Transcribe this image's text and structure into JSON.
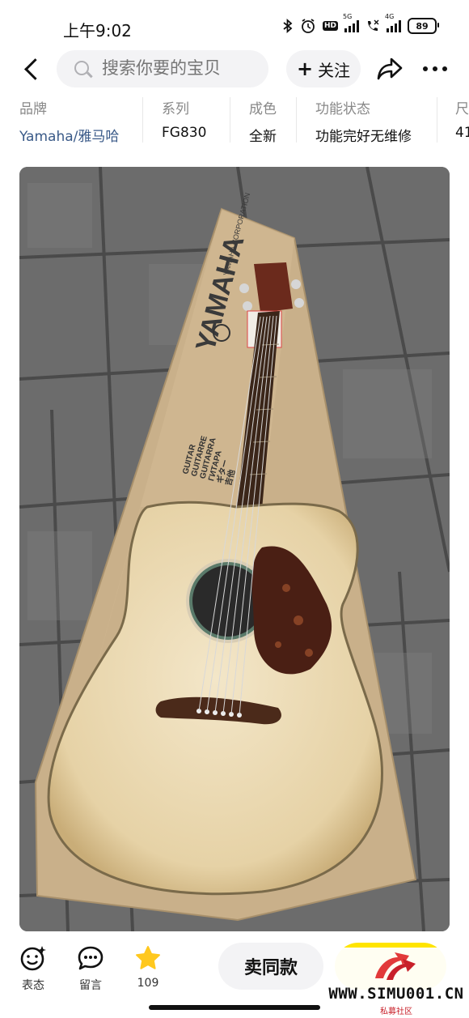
{
  "status_bar": {
    "time": "上午9:02",
    "signal1_label": "5G",
    "signal2_label": "4G",
    "hd_label": "HD",
    "battery": "89",
    "icons": [
      "bluetooth-icon",
      "alarm-icon",
      "hd-icon",
      "signal-icon",
      "call-icon",
      "signal-icon",
      "battery-icon"
    ]
  },
  "nav": {
    "search_placeholder": "搜索你要的宝贝",
    "follow_label": "关注",
    "icons": [
      "back-icon",
      "search-icon",
      "plus-icon",
      "share-icon",
      "more-icon"
    ]
  },
  "attributes": [
    {
      "label": "品牌",
      "value": "Yamaha/雅马哈"
    },
    {
      "label": "系列",
      "value": "FG830"
    },
    {
      "label": "成色",
      "value": "全新"
    },
    {
      "label": "功能状态",
      "value": "功能完好无维修"
    },
    {
      "label": "尺",
      "value": "41"
    }
  ],
  "photo": {
    "box_brand": "YAMAHA",
    "box_text_1": "YAMAHA CORPORATION",
    "box_text_2": "GUITAR",
    "box_text_3": "GUITARRE",
    "box_text_4": "GUITARRA",
    "box_text_5": "ГИТАРА",
    "box_text_6": "ギター",
    "box_text_7": "吉他"
  },
  "bottom_bar": {
    "express_label": "表态",
    "comment_label": "留言",
    "favorite_count": "109",
    "sell_label": "卖同款",
    "colors": {
      "favorite": "#ffc81e",
      "want": "#ffe400"
    }
  },
  "watermark": {
    "site": "WWW.SIMU001.CN",
    "sub": "私募社区"
  }
}
